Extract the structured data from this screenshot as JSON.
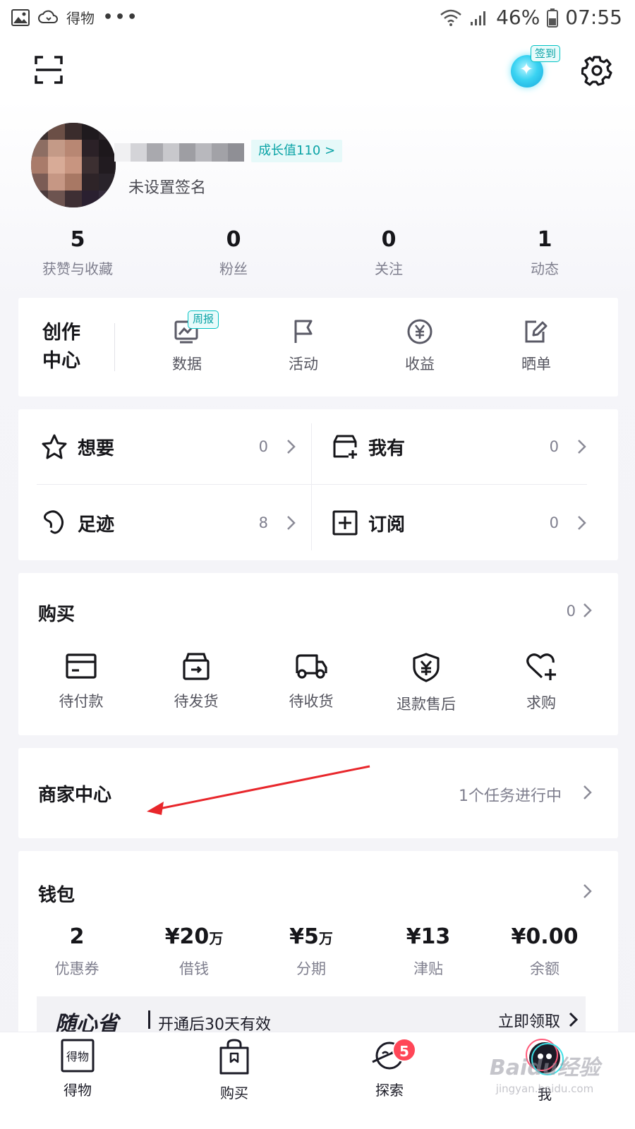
{
  "status_bar": {
    "app_name": "得物",
    "dots": "•••",
    "battery": "46%",
    "time": "07:55"
  },
  "header": {
    "checkin_label": "签到"
  },
  "profile": {
    "growth_badge": "成长值110 >",
    "signature": "未设置签名"
  },
  "stats": [
    {
      "value": "5",
      "label": "获赞与收藏"
    },
    {
      "value": "0",
      "label": "粉丝"
    },
    {
      "value": "0",
      "label": "关注"
    },
    {
      "value": "1",
      "label": "动态"
    }
  ],
  "creator_center": {
    "title_line1": "创作",
    "title_line2": "中心",
    "weekly_tag": "周报",
    "items": [
      {
        "label": "数据",
        "icon": "data-chart-icon"
      },
      {
        "label": "活动",
        "icon": "flag-icon"
      },
      {
        "label": "收益",
        "icon": "yen-coin-icon"
      },
      {
        "label": "晒单",
        "icon": "edit-note-icon"
      }
    ]
  },
  "collections": [
    {
      "label": "想要",
      "count": "0",
      "icon": "star-icon"
    },
    {
      "label": "我有",
      "count": "0",
      "icon": "box-plus-icon"
    },
    {
      "label": "足迹",
      "count": "8",
      "icon": "footprint-icon"
    },
    {
      "label": "订阅",
      "count": "0",
      "icon": "subscribe-plus-icon"
    }
  ],
  "purchase": {
    "title": "购买",
    "count": "0",
    "items": [
      {
        "label": "待付款",
        "icon": "wallet-card-icon"
      },
      {
        "label": "待发货",
        "icon": "package-icon"
      },
      {
        "label": "待收货",
        "icon": "truck-icon"
      },
      {
        "label": "退款售后",
        "icon": "yen-shield-icon"
      },
      {
        "label": "求购",
        "icon": "heart-plus-icon"
      }
    ]
  },
  "merchant": {
    "title": "商家中心",
    "status": "1个任务进行中"
  },
  "wallet": {
    "title": "钱包",
    "items": [
      {
        "value": "2",
        "unit": "",
        "label": "优惠券"
      },
      {
        "value": "¥20",
        "unit": "万",
        "label": "借钱"
      },
      {
        "value": "¥5",
        "unit": "万",
        "label": "分期"
      },
      {
        "value": "¥13",
        "unit": "",
        "label": "津贴"
      },
      {
        "value": "¥0.00",
        "unit": "",
        "label": "余额"
      }
    ],
    "promo": {
      "brand": "随心省",
      "text": "开通后30天有效",
      "cta": "立即领取"
    }
  },
  "tabbar": [
    {
      "label": "得物",
      "icon": "dewu-logo-icon"
    },
    {
      "label": "购买",
      "icon": "shopping-bag-icon"
    },
    {
      "label": "探索",
      "icon": "planet-icon",
      "badge": "5"
    },
    {
      "label": "我",
      "icon": "profile-avatar-icon"
    }
  ],
  "watermark": {
    "main": "Baidu经验",
    "sub": "jingyan.baidu.com"
  },
  "colors": {
    "accent": "#01c2c3",
    "badge_red": "#ff4657",
    "annotation_arrow": "#e8262b"
  }
}
